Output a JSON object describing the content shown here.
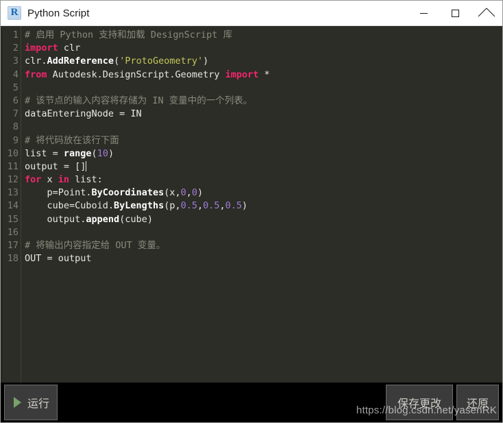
{
  "window": {
    "title": "Python Script",
    "app_icon": "revit-r-icon",
    "icon_letter": "R",
    "controls": {
      "minimize": "minimize-icon",
      "maximize": "maximize-icon",
      "close": "close-icon"
    }
  },
  "editor": {
    "line_numbers": [
      "1",
      "2",
      "3",
      "4",
      "5",
      "6",
      "7",
      "8",
      "9",
      "10",
      "11",
      "12",
      "13",
      "14",
      "15",
      "16",
      "17",
      "18"
    ],
    "lines": [
      {
        "n": "1",
        "tokens": [
          {
            "t": "comment",
            "v": "# 启用 Python 支持和加载 DesignScript 库"
          }
        ]
      },
      {
        "n": "2",
        "tokens": [
          {
            "t": "keyword",
            "v": "import"
          },
          {
            "t": "plain",
            "v": " clr"
          }
        ]
      },
      {
        "n": "3",
        "tokens": [
          {
            "t": "plain",
            "v": "clr."
          },
          {
            "t": "func",
            "v": "AddReference"
          },
          {
            "t": "plain",
            "v": "("
          },
          {
            "t": "string",
            "v": "'ProtoGeometry'"
          },
          {
            "t": "plain",
            "v": ")"
          }
        ]
      },
      {
        "n": "4",
        "tokens": [
          {
            "t": "keyword",
            "v": "from"
          },
          {
            "t": "plain",
            "v": " Autodesk.DesignScript.Geometry "
          },
          {
            "t": "keyword",
            "v": "import"
          },
          {
            "t": "plain",
            "v": " *"
          }
        ]
      },
      {
        "n": "5",
        "tokens": []
      },
      {
        "n": "6",
        "tokens": [
          {
            "t": "comment",
            "v": "# 该节点的输入内容将存储为 IN 变量中的一个列表。"
          }
        ]
      },
      {
        "n": "7",
        "tokens": [
          {
            "t": "plain",
            "v": "dataEnteringNode = IN"
          }
        ]
      },
      {
        "n": "8",
        "tokens": []
      },
      {
        "n": "9",
        "tokens": [
          {
            "t": "comment",
            "v": "# 将代码放在该行下面"
          }
        ]
      },
      {
        "n": "10",
        "tokens": [
          {
            "t": "plain",
            "v": "list = "
          },
          {
            "t": "func",
            "v": "range"
          },
          {
            "t": "plain",
            "v": "("
          },
          {
            "t": "number",
            "v": "10"
          },
          {
            "t": "plain",
            "v": ")"
          }
        ]
      },
      {
        "n": "11",
        "tokens": [
          {
            "t": "plain",
            "v": "output = []"
          }
        ],
        "caret": true
      },
      {
        "n": "12",
        "tokens": [
          {
            "t": "keyword",
            "v": "for"
          },
          {
            "t": "plain",
            "v": " x "
          },
          {
            "t": "keyword",
            "v": "in"
          },
          {
            "t": "plain",
            "v": " list:"
          }
        ]
      },
      {
        "n": "13",
        "tokens": [
          {
            "t": "plain",
            "v": "    p=Point."
          },
          {
            "t": "func",
            "v": "ByCoordinates"
          },
          {
            "t": "plain",
            "v": "(x,"
          },
          {
            "t": "number",
            "v": "0"
          },
          {
            "t": "plain",
            "v": ","
          },
          {
            "t": "number",
            "v": "0"
          },
          {
            "t": "plain",
            "v": ")"
          }
        ]
      },
      {
        "n": "14",
        "tokens": [
          {
            "t": "plain",
            "v": "    cube=Cuboid."
          },
          {
            "t": "func",
            "v": "ByLengths"
          },
          {
            "t": "plain",
            "v": "(p,"
          },
          {
            "t": "number",
            "v": "0.5"
          },
          {
            "t": "plain",
            "v": ","
          },
          {
            "t": "number",
            "v": "0.5"
          },
          {
            "t": "plain",
            "v": ","
          },
          {
            "t": "number",
            "v": "0.5"
          },
          {
            "t": "plain",
            "v": ")"
          }
        ]
      },
      {
        "n": "15",
        "tokens": [
          {
            "t": "plain",
            "v": "    output."
          },
          {
            "t": "func",
            "v": "append"
          },
          {
            "t": "plain",
            "v": "(cube)"
          }
        ]
      },
      {
        "n": "16",
        "tokens": []
      },
      {
        "n": "17",
        "tokens": [
          {
            "t": "comment",
            "v": "# 将输出内容指定给 OUT 变量。"
          }
        ]
      },
      {
        "n": "18",
        "tokens": [
          {
            "t": "plain",
            "v": "OUT = output"
          }
        ]
      }
    ],
    "colors": {
      "background": "#2b2d26",
      "comment": "#8a8c7e",
      "keyword": "#f2256d",
      "string": "#c5c55c",
      "function": "#ffffff",
      "number": "#9f7bd8",
      "plain": "#e8e8e3",
      "gutter_text": "#7d7f76"
    }
  },
  "toolbar": {
    "run_label": "运行",
    "run_icon": "play-triangle-icon",
    "save_label": "保存更改",
    "restore_label": "还原",
    "accent_green": "#77a36a"
  },
  "watermark": {
    "text": "https://blog.csdn.net/yasenRK"
  }
}
